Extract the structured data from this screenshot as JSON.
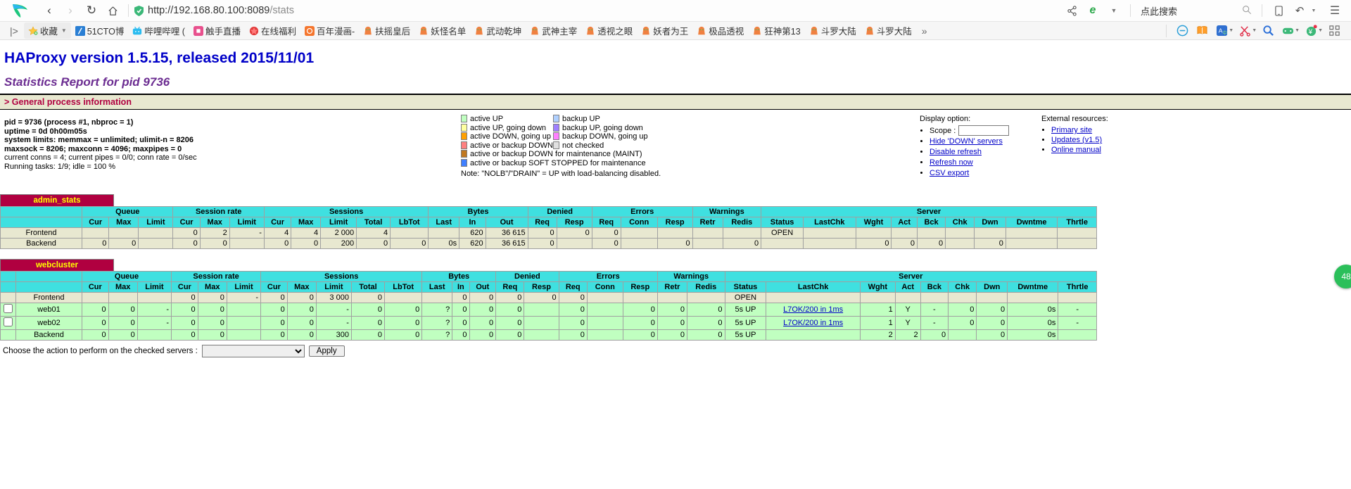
{
  "browser": {
    "url_host": "http://192.168.80.100:8089",
    "url_path": "/stats",
    "search_placeholder": "点此搜索",
    "back_icon": "back-arrow-icon",
    "forward_icon": "forward-arrow-icon",
    "reload_icon": "reload-icon",
    "home_icon": "home-icon",
    "share_icon": "share-icon",
    "ie_icon": "edge-compat-icon",
    "mobile_icon": "mobile-view-icon",
    "history_icon": "history-icon",
    "menu_icon": "hamburger-menu-icon",
    "search_icon": "search-icon"
  },
  "bookmarks": {
    "overflow_label": "»",
    "items": [
      {
        "label": "收藏",
        "icon": "star-favorites-icon",
        "has_chevron": true
      },
      {
        "label": "51CTO博",
        "icon": "51cto-icon"
      },
      {
        "label": "哔哩哔哩 (",
        "icon": "bilibili-icon"
      },
      {
        "label": "触手直播",
        "icon": "chushou-icon"
      },
      {
        "label": "在线福利",
        "icon": "generic-site-icon"
      },
      {
        "label": "百年漫画-",
        "icon": "comic-icon"
      },
      {
        "label": "扶摇皇后",
        "icon": "novel-icon"
      },
      {
        "label": "妖怪名单",
        "icon": "novel-icon"
      },
      {
        "label": "武动乾坤",
        "icon": "novel-icon"
      },
      {
        "label": "武神主宰",
        "icon": "novel-icon"
      },
      {
        "label": "透视之眼",
        "icon": "novel-icon"
      },
      {
        "label": "妖者为王",
        "icon": "novel-icon"
      },
      {
        "label": "极品透视",
        "icon": "novel-icon"
      },
      {
        "label": "狂神第13",
        "icon": "novel-icon"
      },
      {
        "label": "斗罗大陆",
        "icon": "novel-icon"
      },
      {
        "label": "斗罗大陆",
        "icon": "novel-icon"
      }
    ],
    "toolbar_icons": [
      {
        "name": "adblock-icon"
      },
      {
        "name": "reader-mode-icon"
      },
      {
        "name": "translate-icon",
        "caret": true
      },
      {
        "name": "screenshot-scissors-icon",
        "caret": true
      },
      {
        "name": "zoom-search-icon"
      },
      {
        "name": "game-controller-icon",
        "caret": true
      },
      {
        "name": "coupon-icon",
        "caret": true
      },
      {
        "name": "apps-grid-icon"
      }
    ]
  },
  "page": {
    "title": "HAProxy version 1.5.15, released 2015/11/01",
    "subtitle": "Statistics Report for pid 9736",
    "general_header": "> General process information",
    "process_info": [
      "pid = 9736 (process #1, nbproc = 1)",
      "uptime = 0d 0h00m05s",
      "system limits: memmax = unlimited; ulimit-n = 8206",
      "maxsock = 8206; maxconn = 4096; maxpipes = 0",
      "current conns = 4; current pipes = 0/0; conn rate = 0/sec",
      "Running tasks: 1/9; idle = 100 %"
    ],
    "legend_left": [
      {
        "label": "active UP",
        "color": "#c0ffc0"
      },
      {
        "label": "active UP, going down",
        "color": "#ffffa0"
      },
      {
        "label": "active DOWN, going up",
        "color": "#ffa000"
      },
      {
        "label": "active or backup DOWN",
        "color": "#ff8080"
      },
      {
        "label": "active or backup DOWN for maintenance (MAINT)",
        "color": "#c07820"
      },
      {
        "label": "active or backup SOFT STOPPED for maintenance",
        "color": "#3f7fff"
      }
    ],
    "legend_right": [
      {
        "label": "backup UP",
        "color": "#b0d0ff"
      },
      {
        "label": "backup UP, going down",
        "color": "#a080ff"
      },
      {
        "label": "backup DOWN, going up",
        "color": "#ff80ff"
      },
      {
        "label": "not checked",
        "color": "#e0e0e0"
      }
    ],
    "legend_note": "Note: \"NOLB\"/\"DRAIN\" = UP with load-balancing disabled.",
    "display_option": {
      "title": "Display option:",
      "scope_label": "Scope :",
      "scope_value": "",
      "links": [
        "Hide 'DOWN' servers",
        "Disable refresh",
        "Refresh now",
        "CSV export"
      ]
    },
    "external_resources": {
      "title": "External resources:",
      "links": [
        "Primary site",
        "Updates (v1.5)",
        "Online manual"
      ]
    },
    "action_label": "Choose the action to perform on the checked servers :",
    "action_value": "",
    "apply_label": "Apply",
    "float_badge": "48"
  },
  "columns": {
    "groups": [
      {
        "label": "Queue",
        "span": 3
      },
      {
        "label": "Session rate",
        "span": 3
      },
      {
        "label": "Sessions",
        "span": 5
      },
      {
        "label": "Bytes",
        "span": 2
      },
      {
        "label": "Denied",
        "span": 2
      },
      {
        "label": "Errors",
        "span": 3
      },
      {
        "label": "Warnings",
        "span": 2
      },
      {
        "label": "Server",
        "span": 9
      }
    ],
    "sub": [
      "Cur",
      "Max",
      "Limit",
      "Cur",
      "Max",
      "Limit",
      "Cur",
      "Max",
      "Limit",
      "Total",
      "LbTot",
      "Last",
      "In",
      "Out",
      "Req",
      "Resp",
      "Req",
      "Conn",
      "Resp",
      "Retr",
      "Redis",
      "Status",
      "LastChk",
      "Wght",
      "Act",
      "Bck",
      "Chk",
      "Dwn",
      "Dwntme",
      "Thrtle"
    ]
  },
  "proxies": [
    {
      "name": "admin_stats",
      "has_checkbox_col": false,
      "rows": [
        {
          "type": "frontend",
          "label": "Frontend",
          "cells": [
            "",
            "",
            "",
            "0",
            "2",
            "-",
            "4",
            "4",
            "2 000",
            "4",
            "",
            "",
            "620",
            "36 615",
            "0",
            "0",
            "0",
            "",
            "",
            "",
            "",
            "OPEN",
            "",
            "",
            "",
            "",
            "",
            "",
            "",
            ""
          ]
        },
        {
          "type": "backend",
          "label": "Backend",
          "cells": [
            "0",
            "0",
            "",
            "0",
            "0",
            "",
            "0",
            "0",
            "200",
            "0",
            "0",
            "0s",
            "620",
            "36 615",
            "0",
            "",
            "0",
            "",
            "0",
            "",
            "0",
            "",
            "",
            "0",
            "0",
            "0",
            "",
            "0",
            "",
            ""
          ]
        }
      ]
    },
    {
      "name": "webcluster",
      "has_checkbox_col": true,
      "rows": [
        {
          "type": "frontend",
          "label": "Frontend",
          "cells": [
            "",
            "",
            "",
            "0",
            "0",
            "-",
            "0",
            "0",
            "3 000",
            "0",
            "",
            "",
            "0",
            "0",
            "0",
            "0",
            "0",
            "",
            "",
            "",
            "",
            "OPEN",
            "",
            "",
            "",
            "",
            "",
            "",
            "",
            ""
          ]
        },
        {
          "type": "server",
          "label": "web01",
          "checkbox": true,
          "cells": [
            "0",
            "0",
            "-",
            "0",
            "0",
            "",
            "0",
            "0",
            "-",
            "0",
            "0",
            "?",
            "0",
            "0",
            "0",
            "",
            "0",
            "",
            "0",
            "0",
            "0",
            "5s UP",
            "L7OK/200 in 1ms",
            "1",
            "Y",
            "-",
            "0",
            "0",
            "0s",
            "-"
          ]
        },
        {
          "type": "server",
          "label": "web02",
          "checkbox": true,
          "cells": [
            "0",
            "0",
            "-",
            "0",
            "0",
            "",
            "0",
            "0",
            "-",
            "0",
            "0",
            "?",
            "0",
            "0",
            "0",
            "",
            "0",
            "",
            "0",
            "0",
            "0",
            "5s UP",
            "L7OK/200 in 1ms",
            "1",
            "Y",
            "-",
            "0",
            "0",
            "0s",
            "-"
          ]
        },
        {
          "type": "backend",
          "label": "Backend",
          "cells": [
            "0",
            "0",
            "",
            "0",
            "0",
            "",
            "0",
            "0",
            "300",
            "0",
            "0",
            "?",
            "0",
            "0",
            "0",
            "",
            "0",
            "",
            "0",
            "0",
            "0",
            "5s UP",
            "",
            "2",
            "2",
            "0",
            "",
            "0",
            "0s",
            ""
          ]
        }
      ]
    }
  ],
  "colors": {
    "title_blue": "#0000c8",
    "subtitle_purple": "#6b2c91",
    "band_bg": "#e8e8d0",
    "band_text": "#b00040",
    "proxy_title_bg": "#b00040",
    "proxy_title_text": "#ffff00",
    "header_cyan": "#3fe0e0",
    "server_up_green": "#c0ffc0"
  }
}
